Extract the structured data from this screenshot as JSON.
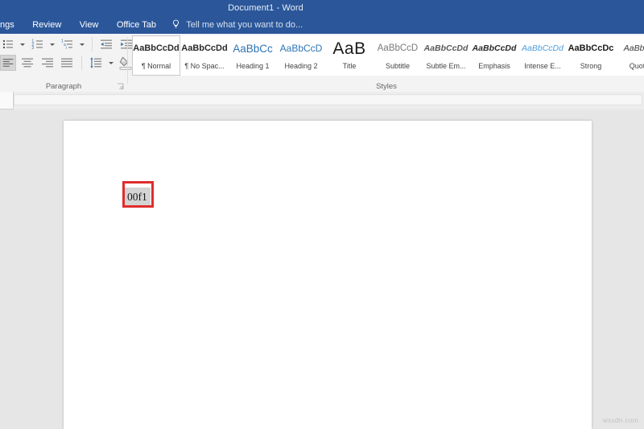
{
  "window": {
    "title": "Document1 - Word",
    "accent_color": "#2b579a"
  },
  "ribbon": {
    "tabs": [
      {
        "label": "ngs",
        "name": "tab-mailings-clipped",
        "active": false
      },
      {
        "label": "Review",
        "name": "tab-review",
        "active": false
      },
      {
        "label": "View",
        "name": "tab-view",
        "active": false
      },
      {
        "label": "Office Tab",
        "name": "tab-office-tab",
        "active": false
      }
    ],
    "tell_me": {
      "label": "Tell me what you want to do...",
      "icon": "lightbulb-icon"
    },
    "groups": {
      "paragraph": {
        "label": "Paragraph",
        "row1": [
          {
            "name": "bullets-button",
            "icon": "bullet-list-icon",
            "has_caret": true
          },
          {
            "name": "numbering-button",
            "icon": "numbered-list-icon",
            "has_caret": true
          },
          {
            "name": "multilevel-list-button",
            "icon": "multilevel-list-icon",
            "has_caret": true
          },
          {
            "name": "decrease-indent-button",
            "icon": "decrease-indent-icon",
            "has_caret": false
          },
          {
            "name": "increase-indent-button",
            "icon": "increase-indent-icon",
            "has_caret": false
          },
          {
            "name": "sort-button",
            "icon": "sort-az-icon",
            "has_caret": false
          },
          {
            "name": "show-formatting-marks-button",
            "icon": "pilcrow-icon",
            "has_caret": false
          }
        ],
        "row2": [
          {
            "name": "align-left-button",
            "icon": "align-left-icon",
            "has_caret": false,
            "active": true
          },
          {
            "name": "align-center-button",
            "icon": "align-center-icon",
            "has_caret": false,
            "active": false
          },
          {
            "name": "align-right-button",
            "icon": "align-right-icon",
            "has_caret": false,
            "active": false
          },
          {
            "name": "justify-button",
            "icon": "align-justify-icon",
            "has_caret": false,
            "active": false
          },
          {
            "name": "line-spacing-button",
            "icon": "line-spacing-icon",
            "has_caret": true,
            "active": false
          },
          {
            "name": "shading-button",
            "icon": "shading-paint-icon",
            "has_caret": true,
            "active": false
          },
          {
            "name": "borders-button",
            "icon": "borders-grid-icon",
            "has_caret": true,
            "active": false
          }
        ]
      },
      "styles": {
        "label": "Styles",
        "items": [
          {
            "preview": "AaBbCcDd",
            "name": "¶ Normal",
            "class": "sp-normal",
            "selected": true
          },
          {
            "preview": "AaBbCcDd",
            "name": "¶ No Spac...",
            "class": "sp-nospace",
            "selected": false
          },
          {
            "preview": "AaBbCc",
            "name": "Heading 1",
            "class": "sp-h1",
            "selected": false
          },
          {
            "preview": "AaBbCcD",
            "name": "Heading 2",
            "class": "sp-h2",
            "selected": false
          },
          {
            "preview": "AaB",
            "name": "Title",
            "class": "sp-title",
            "selected": false
          },
          {
            "preview": "AaBbCcD",
            "name": "Subtitle",
            "class": "sp-subtitle",
            "selected": false
          },
          {
            "preview": "AaBbCcDd",
            "name": "Subtle Em...",
            "class": "sp-subem",
            "selected": false
          },
          {
            "preview": "AaBbCcDd",
            "name": "Emphasis",
            "class": "sp-emph",
            "selected": false
          },
          {
            "preview": "AaBbCcDd",
            "name": "Intense E...",
            "class": "sp-intense",
            "selected": false
          },
          {
            "preview": "AaBbCcDc",
            "name": "Strong",
            "class": "sp-strong",
            "selected": false
          },
          {
            "preview": "AaBbCc",
            "name": "Quote",
            "class": "sp-quote",
            "selected": false
          }
        ]
      }
    }
  },
  "document": {
    "selected_text": "00f1",
    "annotation_color": "#e02d2d"
  },
  "watermark": {
    "text": "wsxdn.com"
  }
}
